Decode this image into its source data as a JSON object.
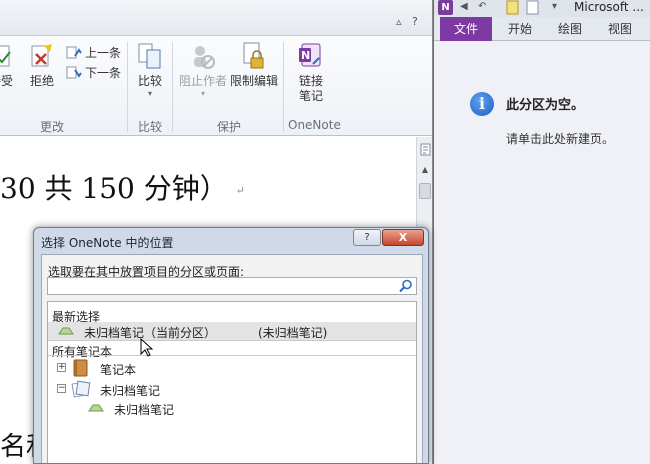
{
  "word": {
    "ribbon": {
      "accept_label": "接受",
      "reject_label": "拒绝",
      "prev_label": "上一条",
      "next_label": "下一条",
      "compare_label": "比较",
      "block_authors_label": "阻止作者",
      "restrict_editing_label": "限制编辑",
      "link_notes_label": "链接\n笔记",
      "link_notes_line1": "链接",
      "link_notes_line2": "笔记",
      "groups": [
        "更改",
        "比较",
        "保护",
        "OneNote"
      ]
    },
    "document": {
      "line1": "30  共 150 分钟）",
      "pilcrow": "↵",
      "line2": "名和"
    }
  },
  "onenote": {
    "title": "Microsoft ...",
    "tabs": [
      "文件",
      "开始",
      "绘图",
      "视图"
    ],
    "empty_title": "此分区为空。",
    "empty_sub": "请单击此处新建页。"
  },
  "dialog": {
    "title": "选择 OneNote 中的位置",
    "help_label": "?",
    "close_label": "X",
    "prompt": "选取要在其中放置项目的分区或页面:",
    "search_value": "",
    "recent_header": "最新选择",
    "recent_item_name": "未归档笔记（当前分区）",
    "recent_item_path": "(未归档笔记)",
    "all_header": "所有笔记本",
    "notebooks": [
      {
        "name": "笔记本",
        "expander": "+"
      },
      {
        "name": "未归档笔记",
        "expander": "−"
      }
    ],
    "section_name": "未归档笔记"
  },
  "colors": {
    "onenote_purple": "#7d3aa3",
    "close_red": "#c7452d",
    "info_blue": "#1c5fbf"
  }
}
